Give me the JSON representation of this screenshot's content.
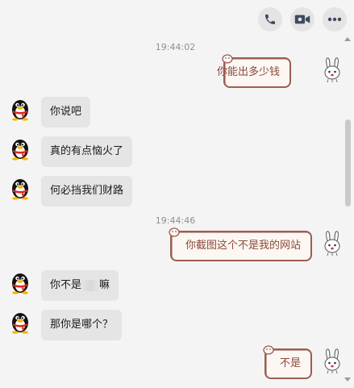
{
  "toolbar": {
    "call_icon": "phone-icon",
    "video_icon": "video-camera-icon",
    "more_icon": "more-dots-icon"
  },
  "colors": {
    "background": "#f4f4f4",
    "incoming_bubble": "#e5e5e5",
    "outgoing_border": "#9b5e53",
    "outgoing_text": "#8a4a3a",
    "timestamp": "#909090"
  },
  "messages": [
    {
      "type": "timestamp",
      "text": "19:44:02"
    },
    {
      "type": "outgoing",
      "text": "你能出多少钱"
    },
    {
      "type": "incoming",
      "text": "你说吧"
    },
    {
      "type": "incoming",
      "text": "真的有点恼火了"
    },
    {
      "type": "incoming",
      "text": "何必挡我们财路"
    },
    {
      "type": "timestamp",
      "text": "19:44:46"
    },
    {
      "type": "outgoing",
      "text": "你截图这个不是我的网站"
    },
    {
      "type": "incoming",
      "text": "你不是",
      "suffix": "嘛",
      "redacted": true
    },
    {
      "type": "incoming",
      "text": "那你是哪个？"
    },
    {
      "type": "outgoing",
      "text": "不是"
    }
  ]
}
